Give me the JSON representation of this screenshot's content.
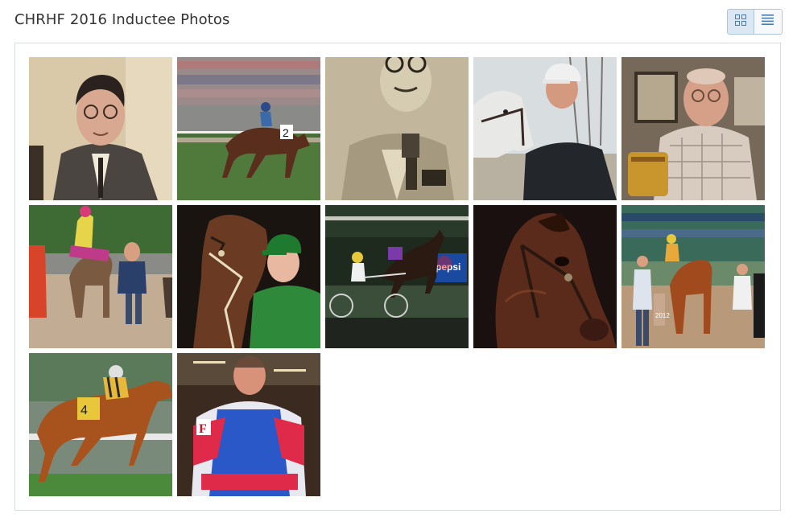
{
  "page": {
    "title": "CHRHF 2016 Inductee Photos"
  },
  "view_toggle": {
    "grid_icon": "grid-view-icon",
    "list_icon": "list-view-icon",
    "active": "grid"
  },
  "gallery": {
    "photos": [
      {
        "subject": "man-portrait-sepia-glasses"
      },
      {
        "subject": "racehorse-finish-grandstand"
      },
      {
        "subject": "man-with-camera-newsprint"
      },
      {
        "subject": "man-with-grey-horse"
      },
      {
        "subject": "man-holding-trophy"
      },
      {
        "subject": "jockey-horse-post-parade"
      },
      {
        "subject": "groom-with-horse-green-jacket"
      },
      {
        "subject": "harness-racing-night"
      },
      {
        "subject": "bay-horse-portrait"
      },
      {
        "subject": "winners-circle-walk"
      },
      {
        "subject": "chestnut-racehorse-galloping"
      },
      {
        "subject": "harness-driver-colours"
      }
    ]
  }
}
